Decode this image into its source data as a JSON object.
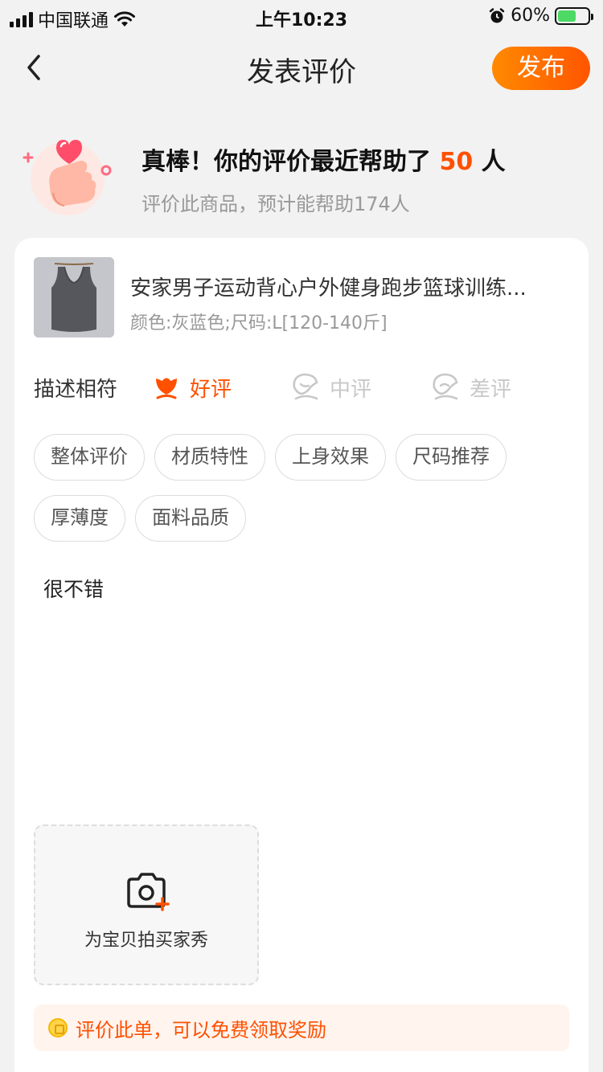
{
  "status_bar": {
    "carrier": "中国联通",
    "time": "上午10:23",
    "battery": "60%",
    "battery_level": 0.6
  },
  "nav": {
    "title": "发表评价",
    "publish_label": "发布"
  },
  "help": {
    "title_prefix": "真棒！你的评价最近帮助了",
    "count": "50",
    "title_suffix": "人",
    "subtitle": "评价此商品，预计能帮助174人"
  },
  "product": {
    "name": "安家男子运动背心户外健身跑步篮球训练...",
    "spec": "颜色:灰蓝色;尺码:L[120-140斤]"
  },
  "rating": {
    "label": "描述相符",
    "good": "好评",
    "mid": "中评",
    "bad": "差评",
    "selected": "好评"
  },
  "tags": [
    "整体评价",
    "材质特性",
    "上身效果",
    "尺码推荐",
    "厚薄度",
    "面料品质"
  ],
  "review": {
    "text": "很不错"
  },
  "photo": {
    "label": "为宝贝拍买家秀"
  },
  "reward": {
    "text": "评价此单，可以免费领取奖励"
  },
  "colors": {
    "accent": "#ff5000",
    "publish_gradient_start": "#ff8a00",
    "publish_gradient_end": "#ff5500"
  }
}
